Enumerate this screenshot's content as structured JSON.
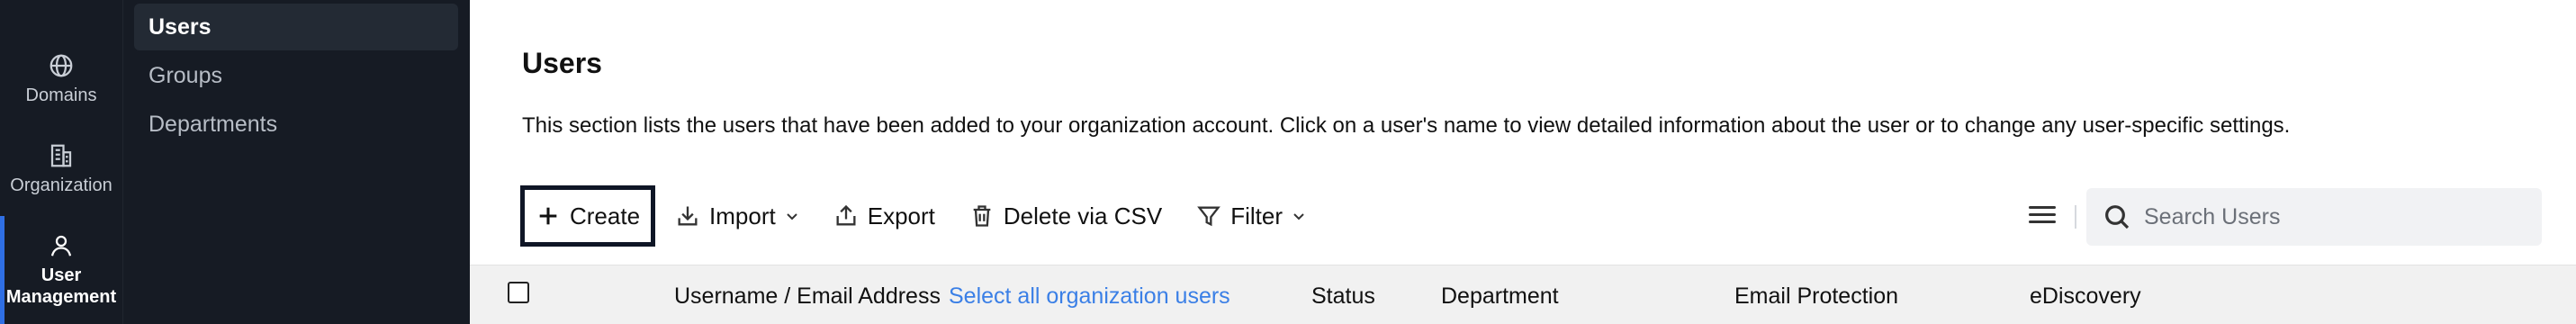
{
  "rail": {
    "items": [
      {
        "label": "Domains",
        "icon": "globe-icon"
      },
      {
        "label": "Organization",
        "icon": "building-icon"
      },
      {
        "label": "User Management",
        "icon": "user-icon",
        "active": true
      }
    ],
    "accent": "#2f6fe4",
    "background": "#161b24"
  },
  "subnav": {
    "items": [
      {
        "label": "Users",
        "active": true
      },
      {
        "label": "Groups"
      },
      {
        "label": "Departments"
      }
    ]
  },
  "main": {
    "title": "Users",
    "description": "This section lists the users that have been added to your organization account. Click on a user's name to view detailed information about the user or to change any user-specific settings."
  },
  "toolbar": {
    "create": "Create",
    "import": "Import",
    "export": "Export",
    "delete_csv": "Delete via CSV",
    "filter": "Filter"
  },
  "search": {
    "placeholder": "Search Users"
  },
  "table": {
    "columns": [
      "Username / Email Address",
      "Status",
      "Department",
      "Email Protection",
      "eDiscovery"
    ],
    "select_all_link": "Select all organization users",
    "link_color": "#3a7fe6"
  }
}
